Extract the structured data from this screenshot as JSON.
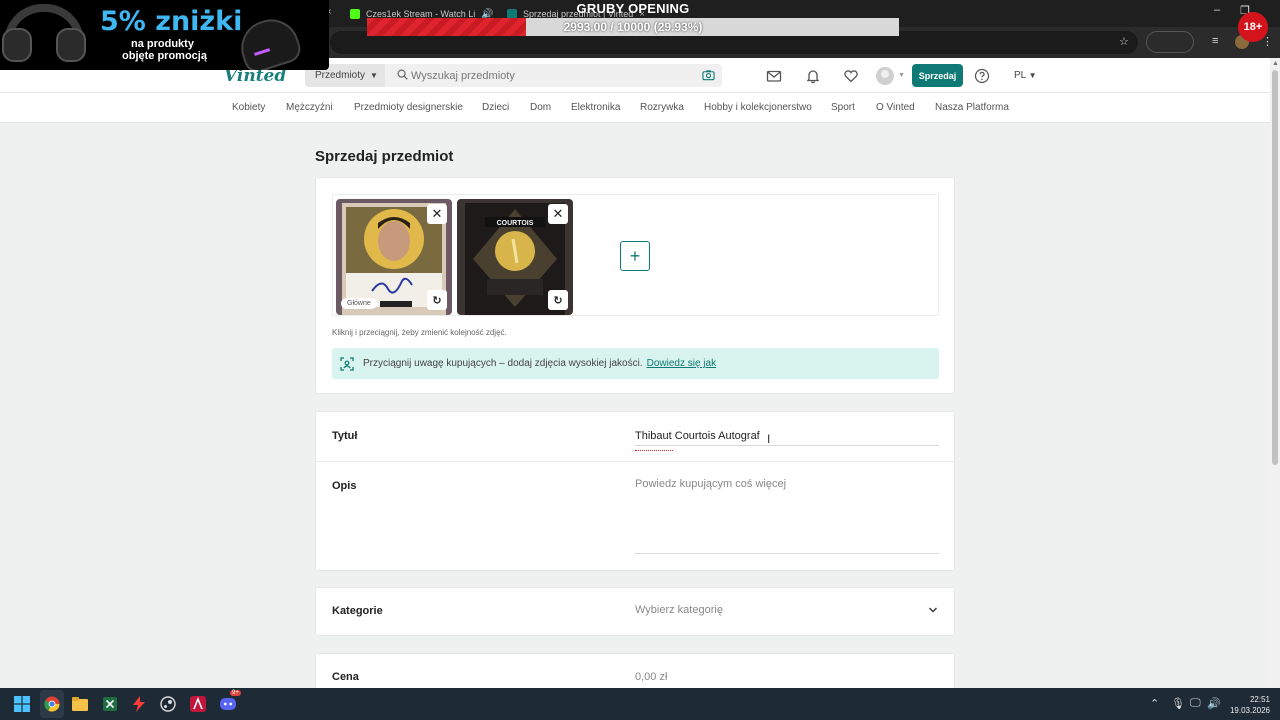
{
  "browser": {
    "tabs": [
      {
        "title": "Czes1ek Stream - Watch Li",
        "favicon_color": "#53fc18"
      },
      {
        "title": "Sprzedaj przedmiot | Vinted",
        "favicon_color": "#0f7a75"
      }
    ],
    "overlay_goal": {
      "title": "GRUBY OPENING",
      "progress_text": "2993.00 / 10000 (29.93%)",
      "progress_fraction": 0.2993
    },
    "overlay_badge": "18+",
    "ad": {
      "headline": "5% zniżki",
      "line1": "na produkty",
      "line2": "objęte promocją"
    }
  },
  "header": {
    "logo": "Vinted",
    "search_category": "Przedmioty",
    "search_placeholder": "Wyszukaj przedmioty",
    "sell_button": "Sprzedaj",
    "language": "PL"
  },
  "categories": [
    "Kobiety",
    "Mężczyźni",
    "Przedmioty designerskie",
    "Dzieci",
    "Dom",
    "Elektronika",
    "Rozrywka",
    "Hobby i kolekcjonerstwo",
    "Sport",
    "O Vinted",
    "Nasza Platforma"
  ],
  "form": {
    "page_title": "Sprzedaj przedmiot",
    "photos": [
      {
        "main_label": "Główne",
        "caption": "COURTOIS"
      },
      {
        "main_label": "",
        "caption": "COURTOIS"
      }
    ],
    "reorder_hint": "Kliknij i przeciągnij, żeby zmienić kolejność zdjęć.",
    "tip_text": "Przyciągnij uwagę kupujących – dodaj zdjęcia wysokiej jakości.",
    "tip_link": "Dowiedz się jak",
    "title_label": "Tytuł",
    "title_value": "Thibaut Courtois Autograf",
    "description_label": "Opis",
    "description_placeholder": "Powiedz kupującym coś więcej",
    "category_label": "Kategorie",
    "category_placeholder": "Wybierz kategorię",
    "price_label": "Cena",
    "price_placeholder": "0,00 zł"
  },
  "taskbar": {
    "time": "22:51",
    "date": "19.03.2026",
    "discord_badge": "9+"
  },
  "colors": {
    "brand": "#0f7a75",
    "tip_bg": "#d9f3ee",
    "goal_fill": "#e0242e"
  }
}
